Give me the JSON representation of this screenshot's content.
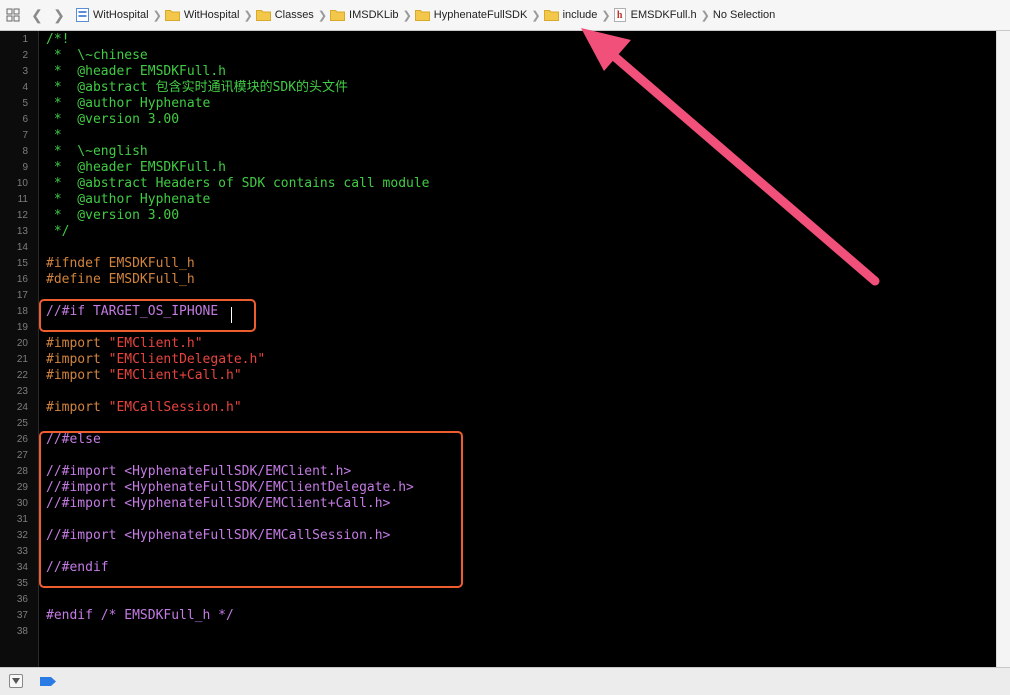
{
  "jumpbar": {
    "icons": [
      "grid-icon",
      "chevron-left-icon",
      "chevron-right-icon"
    ],
    "crumbs": [
      {
        "label": "WitHospital",
        "icon": "project-icon"
      },
      {
        "label": "WitHospital",
        "icon": "folder-icon"
      },
      {
        "label": "Classes",
        "icon": "folder-icon"
      },
      {
        "label": "IMSDKLib",
        "icon": "folder-icon"
      },
      {
        "label": "HyphenateFullSDK",
        "icon": "folder-icon"
      },
      {
        "label": "include",
        "icon": "folder-icon"
      },
      {
        "label": "EMSDKFull.h",
        "icon": "header-file-icon"
      },
      {
        "label": "No Selection",
        "icon": ""
      }
    ],
    "header_file_letter": "h"
  },
  "editor": {
    "lines": [
      {
        "n": "1",
        "text": "/*!",
        "kind": "comment"
      },
      {
        "n": "2",
        "text": " *  \\~chinese",
        "kind": "comment"
      },
      {
        "n": "3",
        "text": " *  @header EMSDKFull.h",
        "kind": "comment"
      },
      {
        "n": "4",
        "text": " *  @abstract 包含实时通讯模块的SDK的头文件",
        "kind": "comment"
      },
      {
        "n": "5",
        "text": " *  @author Hyphenate",
        "kind": "comment"
      },
      {
        "n": "6",
        "text": " *  @version 3.00",
        "kind": "comment"
      },
      {
        "n": "7",
        "text": " *",
        "kind": "comment"
      },
      {
        "n": "8",
        "text": " *  \\~english",
        "kind": "comment"
      },
      {
        "n": "9",
        "text": " *  @header EMSDKFull.h",
        "kind": "comment"
      },
      {
        "n": "10",
        "text": " *  @abstract Headers of SDK contains call module",
        "kind": "comment"
      },
      {
        "n": "11",
        "text": " *  @author Hyphenate",
        "kind": "comment"
      },
      {
        "n": "12",
        "text": " *  @version 3.00",
        "kind": "comment"
      },
      {
        "n": "13",
        "text": " */",
        "kind": "comment"
      },
      {
        "n": "14",
        "text": "",
        "kind": "plain"
      },
      {
        "n": "15",
        "text": "#ifndef EMSDKFull_h",
        "kind": "directive"
      },
      {
        "n": "16",
        "text": "#define EMSDKFull_h",
        "kind": "directive"
      },
      {
        "n": "17",
        "text": "",
        "kind": "plain"
      },
      {
        "n": "18",
        "text": "//#if TARGET_OS_IPHONE",
        "kind": "disabled"
      },
      {
        "n": "19",
        "text": "",
        "kind": "plain"
      },
      {
        "n": "20",
        "pre": "#import ",
        "str": "\"EMClient.h\"",
        "kind": "import"
      },
      {
        "n": "21",
        "pre": "#import ",
        "str": "\"EMClientDelegate.h\"",
        "kind": "import"
      },
      {
        "n": "22",
        "pre": "#import ",
        "str": "\"EMClient+Call.h\"",
        "kind": "import"
      },
      {
        "n": "23",
        "text": "",
        "kind": "plain"
      },
      {
        "n": "24",
        "pre": "#import ",
        "str": "\"EMCallSession.h\"",
        "kind": "import"
      },
      {
        "n": "25",
        "text": "",
        "kind": "plain"
      },
      {
        "n": "26",
        "text": "//#else",
        "kind": "disabled"
      },
      {
        "n": "27",
        "text": "",
        "kind": "plain"
      },
      {
        "n": "28",
        "text": "//#import <HyphenateFullSDK/EMClient.h>",
        "kind": "disabled"
      },
      {
        "n": "29",
        "text": "//#import <HyphenateFullSDK/EMClientDelegate.h>",
        "kind": "disabled"
      },
      {
        "n": "30",
        "text": "//#import <HyphenateFullSDK/EMClient+Call.h>",
        "kind": "disabled"
      },
      {
        "n": "31",
        "text": "",
        "kind": "plain"
      },
      {
        "n": "32",
        "text": "//#import <HyphenateFullSDK/EMCallSession.h>",
        "kind": "disabled"
      },
      {
        "n": "33",
        "text": "",
        "kind": "plain"
      },
      {
        "n": "34",
        "text": "//#endif",
        "kind": "disabled"
      },
      {
        "n": "35",
        "text": "",
        "kind": "plain"
      },
      {
        "n": "36",
        "text": "",
        "kind": "plain"
      },
      {
        "n": "37",
        "text": "#endif /* EMSDKFull_h */",
        "kind": "disabled"
      },
      {
        "n": "38",
        "text": "",
        "kind": "plain"
      }
    ]
  },
  "annotations": {
    "highlight_color": "#ee5d2f",
    "arrow_color": "#f0507a",
    "arrow_target": "include"
  },
  "colors": {
    "comment": "#41cc45",
    "directive": "#d2833e",
    "string": "#e8443e",
    "disabled": "#c47be3",
    "background": "#000000"
  },
  "debugbar": {
    "icons": [
      "hide-debug-area-icon",
      "breakpoints-icon"
    ]
  }
}
